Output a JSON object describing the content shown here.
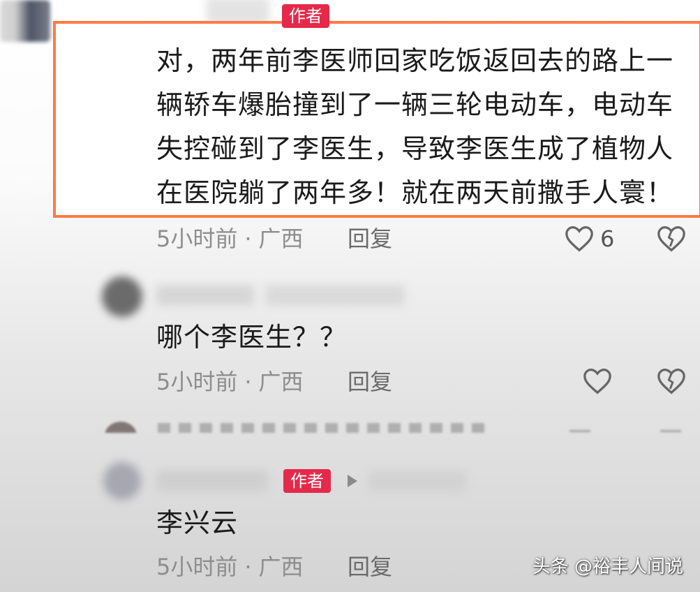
{
  "comments": [
    {
      "author_badge": "作者",
      "text_lines": [
        "对，两年前李医师回家吃饭返回去的路上一",
        "辆轿车爆胎撞到了一辆三轮电动车，电动车",
        "失控碰到了李医生，导致李医生成了植物人",
        "在医院躺了两年多！就在两天前撒手人寰！"
      ],
      "time": "5小时前",
      "location": "广西",
      "reply_label": "回复",
      "likes": "6"
    },
    {
      "text": "哪个李医生？？",
      "time": "5小时前",
      "location": "广西",
      "reply_label": "回复"
    },
    {
      "author_badge": "作者",
      "text": "李兴云",
      "time": "5小时前",
      "location": "广西",
      "reply_label": "回复"
    }
  ],
  "separator": "·",
  "watermark": "头条 @裕丰人间说",
  "colors": {
    "highlight_border": "#ff7a45",
    "author_badge_bg": "#e5294a"
  },
  "icons": {
    "like": "heart-outline-icon",
    "dislike": "broken-heart-icon"
  }
}
